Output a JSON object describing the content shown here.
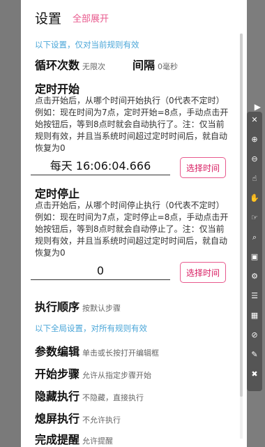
{
  "dialog": {
    "title": "设置",
    "expand_all": "全部展开",
    "current_rule_note": "以下设置，仅对当前规则有效",
    "loop_count": {
      "label": "循环次数",
      "value": "无限次"
    },
    "interval": {
      "label": "间隔",
      "value": "0毫秒"
    },
    "start": {
      "label": "定时开始",
      "desc": "点击开始后，从哪个时间开始执行（0代表不定时）例如：现在时间为7点，定时开始=8点，手动点击开始按钮后，等到8点时就会自动执行了。注：仅当前规则有效，并且当系统时间超过定时时间后，就自动恢复为0",
      "value": "每天 16:06:04.666",
      "button": "选择时间"
    },
    "stop": {
      "label": "定时停止",
      "desc": "点击开始后，从哪个时间停止执行（0代表不定时）例如：现在时间为7点，定时停止=8点，手动点击开始按钮后，等到8点时就会自动停止了。注：仅当前规则有效，并且当系统时间超过定时时间后，就自动恢复为0",
      "value": "0",
      "button": "选择时间"
    },
    "order": {
      "label": "执行顺序",
      "value": "按默认步骤"
    },
    "global_note": "以下全局设置，对所有规则有效",
    "param_edit": {
      "label": "参数编辑",
      "value": "单击或长按打开编辑框"
    },
    "start_step": {
      "label": "开始步骤",
      "value": "允许从指定步骤开始"
    },
    "hidden_exec": {
      "label": "隐藏执行",
      "value": "不隐藏，直接执行"
    },
    "screen_off_exec": {
      "label": "熄屏执行",
      "value": "不允许执行"
    },
    "finish_remind": {
      "label": "完成提醒",
      "value": "允许提醒"
    }
  },
  "colors": {
    "accent_pink": "#e8598d",
    "note_blue": "#4aa6d8"
  }
}
